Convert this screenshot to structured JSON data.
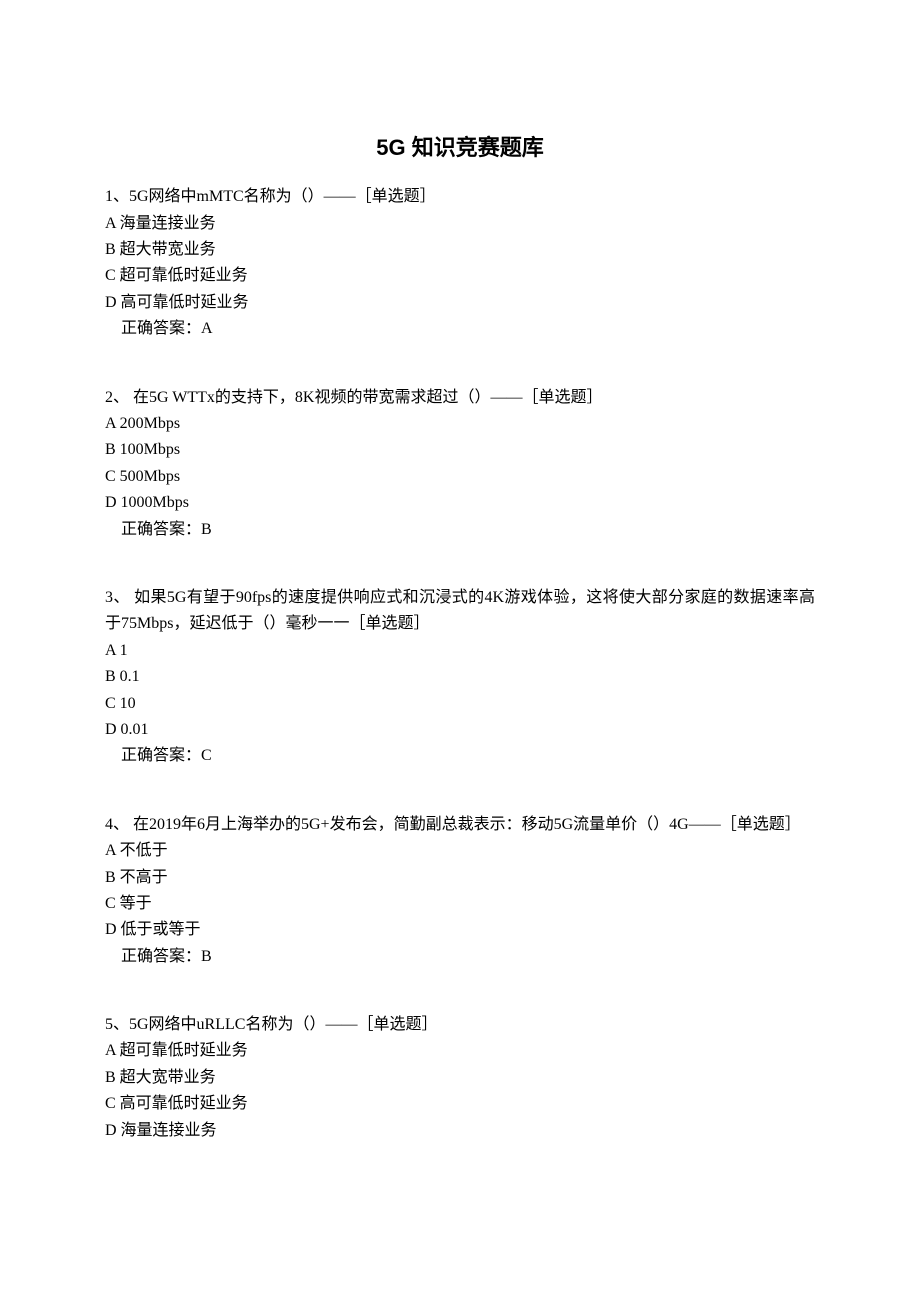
{
  "title": "5G 知识竞赛题库",
  "questions": [
    {
      "q": "1、5G网络中mMTC名称为（）——［单选题］",
      "opts": [
        "A 海量连接业务",
        "B 超大带宽业务",
        "C 超可靠低时延业务",
        "D 高可靠低时延业务"
      ],
      "ans": "正确答案：A"
    },
    {
      "q": "2、 在5G WTTx的支持下，8K视频的带宽需求超过（）——［单选题］",
      "opts": [
        "A 200Mbps",
        "B 100Mbps",
        "C 500Mbps",
        "D 1000Mbps"
      ],
      "ans": "正确答案：B"
    },
    {
      "q": "3、 如果5G有望于90fps的速度提供响应式和沉浸式的4K游戏体验，这将使大部分家庭的数据速率高于75Mbps，延迟低于（）毫秒一一［单选题］",
      "opts": [
        "A 1",
        "B 0.1",
        "C 10",
        "D 0.01"
      ],
      "ans": "正确答案：C"
    },
    {
      "q": "4、 在2019年6月上海举办的5G+发布会，简勤副总裁表示：移动5G流量单价（）4G——［单选题］",
      "opts": [
        "A 不低于",
        "B 不高于",
        "C 等于",
        "D 低于或等于"
      ],
      "ans": "正确答案：B"
    },
    {
      "q": "5、5G网络中uRLLC名称为（）——［单选题］",
      "opts": [
        "A 超可靠低时延业务",
        "B 超大宽带业务",
        "C 高可靠低时延业务",
        "D 海量连接业务"
      ],
      "ans": ""
    }
  ]
}
